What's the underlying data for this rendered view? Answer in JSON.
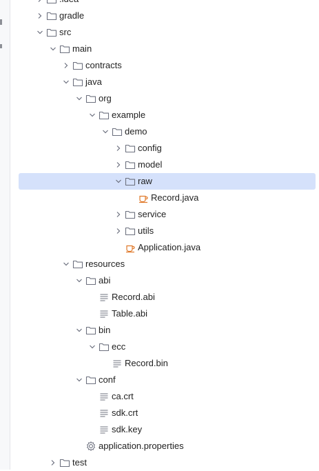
{
  "tree": [
    {
      "label": ".idea",
      "type": "folder",
      "depth": 0,
      "state": "collapsed"
    },
    {
      "label": "gradle",
      "type": "folder",
      "depth": 0,
      "state": "collapsed"
    },
    {
      "label": "src",
      "type": "folder",
      "depth": 0,
      "state": "expanded"
    },
    {
      "label": "main",
      "type": "folder",
      "depth": 1,
      "state": "expanded"
    },
    {
      "label": "contracts",
      "type": "folder",
      "depth": 2,
      "state": "collapsed"
    },
    {
      "label": "java",
      "type": "folder",
      "depth": 2,
      "state": "expanded"
    },
    {
      "label": "org",
      "type": "folder",
      "depth": 3,
      "state": "expanded"
    },
    {
      "label": "example",
      "type": "folder",
      "depth": 4,
      "state": "expanded"
    },
    {
      "label": "demo",
      "type": "folder",
      "depth": 5,
      "state": "expanded"
    },
    {
      "label": "config",
      "type": "folder",
      "depth": 6,
      "state": "collapsed"
    },
    {
      "label": "model",
      "type": "folder",
      "depth": 6,
      "state": "collapsed"
    },
    {
      "label": "raw",
      "type": "folder",
      "depth": 6,
      "state": "expanded",
      "selected": true
    },
    {
      "label": "Record.java",
      "type": "java",
      "depth": 7
    },
    {
      "label": "service",
      "type": "folder",
      "depth": 6,
      "state": "collapsed"
    },
    {
      "label": "utils",
      "type": "folder",
      "depth": 6,
      "state": "collapsed"
    },
    {
      "label": "Application.java",
      "type": "java",
      "depth": 6
    },
    {
      "label": "resources",
      "type": "folder",
      "depth": 2,
      "state": "expanded"
    },
    {
      "label": "abi",
      "type": "folder",
      "depth": 3,
      "state": "expanded"
    },
    {
      "label": "Record.abi",
      "type": "text",
      "depth": 4
    },
    {
      "label": "Table.abi",
      "type": "text",
      "depth": 4
    },
    {
      "label": "bin",
      "type": "folder",
      "depth": 3,
      "state": "expanded"
    },
    {
      "label": "ecc",
      "type": "folder",
      "depth": 4,
      "state": "expanded"
    },
    {
      "label": "Record.bin",
      "type": "text",
      "depth": 5
    },
    {
      "label": "conf",
      "type": "folder",
      "depth": 3,
      "state": "expanded"
    },
    {
      "label": "ca.crt",
      "type": "text",
      "depth": 4
    },
    {
      "label": "sdk.crt",
      "type": "text",
      "depth": 4
    },
    {
      "label": "sdk.key",
      "type": "text",
      "depth": 4
    },
    {
      "label": "application.properties",
      "type": "properties",
      "depth": 3
    },
    {
      "label": "test",
      "type": "folder",
      "depth": 1,
      "state": "collapsed"
    }
  ],
  "colors": {
    "selection": "#d5e1fb",
    "java_icon": "#e0792a",
    "folder_stroke": "#6c707e",
    "text": "#1f1f1f"
  }
}
